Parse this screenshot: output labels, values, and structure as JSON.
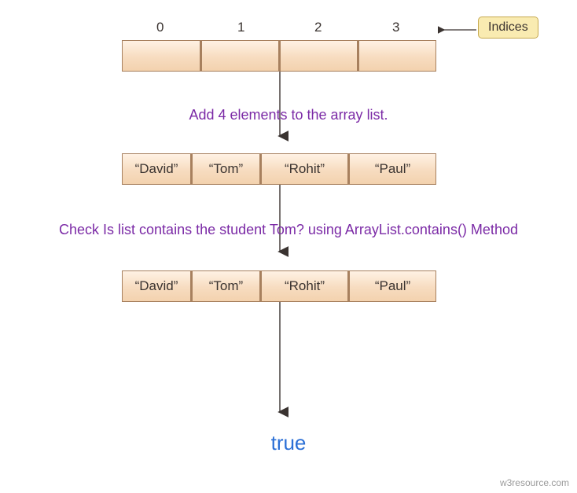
{
  "indices_label": "Indices",
  "indices": [
    "0",
    "1",
    "2",
    "3"
  ],
  "row1_cells": [
    "",
    "",
    "",
    ""
  ],
  "caption1": "Add 4 elements to the array list.",
  "row2_cells": [
    "“David”",
    "“Tom”",
    "“Rohit”",
    "“Paul”"
  ],
  "caption2": "Check Is list contains the student Tom? using ArrayList.contains() Method",
  "row3_cells": [
    "“David”",
    "“Tom”",
    "“Rohit”",
    "“Paul”"
  ],
  "result": "true",
  "watermark": "w3resource.com"
}
